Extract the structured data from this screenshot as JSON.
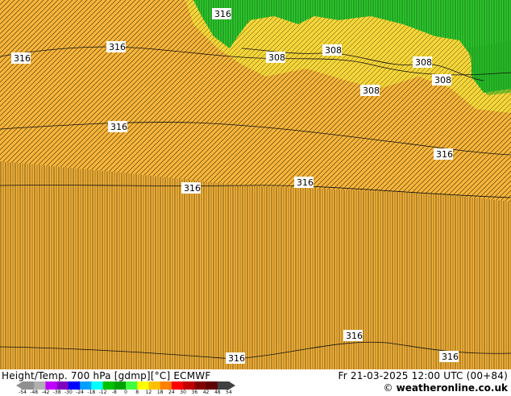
{
  "map": {
    "contour_labels": [
      "316",
      "316",
      "316",
      "308",
      "308",
      "308",
      "308",
      "308",
      "316",
      "316",
      "316",
      "316",
      "316",
      "316",
      "316"
    ]
  },
  "footer": {
    "title_left": "Height/Temp. 700 hPa [gdmp][°C] ECMWF",
    "title_right": "Fr 21-03-2025 12:00 UTC (00+84)",
    "credit": "weatheronline.co.uk",
    "credit_symbol": "©"
  },
  "colorbar": {
    "ticks": [
      "-54",
      "-48",
      "-42",
      "-38",
      "-30",
      "-24",
      "-18",
      "-12",
      "-8",
      "0",
      "8",
      "12",
      "18",
      "24",
      "30",
      "36",
      "42",
      "48",
      "54"
    ],
    "colors": [
      "#909090",
      "#b0b0b0",
      "#c000ff",
      "#8000c0",
      "#0000ff",
      "#00a0ff",
      "#00ffff",
      "#00c000",
      "#00a000",
      "#40ff40",
      "#ffff00",
      "#ffc000",
      "#ff8000",
      "#ff0000",
      "#c00000",
      "#800000",
      "#600000",
      "#404040"
    ]
  },
  "colors": {
    "warm_field": "#f7b53c",
    "cool_field": "#2ecc2e",
    "cold_field": "#22aa22",
    "transition": "#f5d53a"
  }
}
